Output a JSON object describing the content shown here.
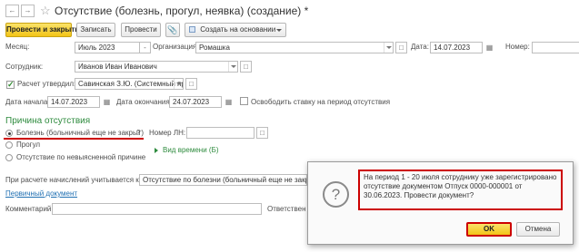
{
  "window": {
    "title": "Отсутствие (болезнь, прогул, неявка) (создание) *"
  },
  "toolbar": {
    "post_and_close": "Провести и закрыть",
    "save": "Записать",
    "post": "Провести",
    "create_based_on": "Создать на основании"
  },
  "form": {
    "month_label": "Месяц:",
    "month_value": "Июль 2023",
    "org_label": "Организация:",
    "org_value": "Ромашка",
    "date_label": "Дата:",
    "date_value": "14.07.2023",
    "number_label": "Номер:",
    "number_value": "",
    "employee_label": "Сотрудник:",
    "employee_value": "Иванов Иван Иванович",
    "calc_approved_label": "Расчет утвердил:",
    "calc_approved_value": "Савинская З.Ю. (Системный прог",
    "start_label": "Дата начала:",
    "start_value": "14.07.2023",
    "end_label": "Дата окончания:",
    "end_value": "24.07.2023",
    "release_rate_label": "Освободить ставку на период отсутствия",
    "reason_heading": "Причина отсутствия",
    "reason_illness": "Болезнь (больничный еще не закрыт)",
    "reason_illness_help": "?",
    "sick_number_label": "Номер ЛН:",
    "sick_number_value": "",
    "reason_absence": "Прогул",
    "reason_unexplained": "Отсутствие по невыясненной причине",
    "time_type_link": "Вид времени (Б)",
    "calc_consider_label": "При расчете начислений учитывается как:",
    "calc_consider_value": "Отсутствие по болезни (больничный еще не закрыт)",
    "primary_doc_link": "Первичный документ",
    "comment_label": "Комментарий:",
    "comment_value": "",
    "responsible_label": "Ответствен"
  },
  "dialog": {
    "icon": "question-icon",
    "message": "На период 1 - 20 июля сотруднику уже зарегистрировано отсутствие документом Отпуск 0000-000001 от 30.06.2023. Провести документ?",
    "ok": "OK",
    "cancel": "Отмена"
  },
  "colors": {
    "primary_button": "#f2c417",
    "green_heading": "#2e8b3e",
    "link": "#1f6fb2",
    "highlight_red": "#cc0000"
  }
}
